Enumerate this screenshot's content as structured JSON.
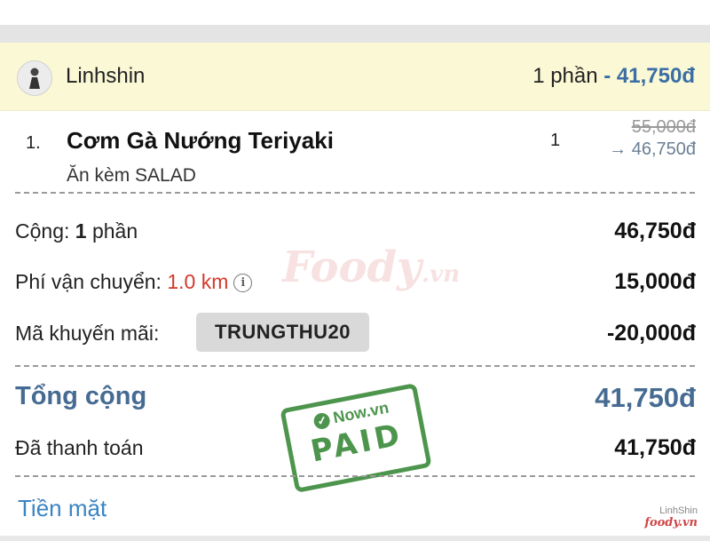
{
  "user": {
    "name": "Linhshin",
    "summary_count": "1 phần",
    "summary_amount": "- 41,750đ"
  },
  "items": [
    {
      "index": "1.",
      "name": "Cơm Gà Nướng Teriyaki",
      "note": "Ăn kèm SALAD",
      "quantity": "1",
      "original_price": "55,000đ",
      "discounted_price": "→ 46,750đ"
    }
  ],
  "summary": {
    "subtotal_label_prefix": "Cộng: ",
    "subtotal_count": "1",
    "subtotal_label_suffix": " phần",
    "subtotal_value": "46,750đ",
    "shipping_label": "Phí vận chuyển: ",
    "shipping_distance": "1.0 km",
    "shipping_value": "15,000đ",
    "promo_label": "Mã khuyến mãi:",
    "promo_code": "TRUNGTHU20",
    "promo_value": "-20,000đ",
    "total_label": "Tổng cộng",
    "total_value": "41,750đ",
    "paid_label": "Đã thanh toán",
    "paid_value": "41,750đ"
  },
  "payment_method": "Tiền mặt",
  "watermark": {
    "brand": "Foody",
    "suffix": ".vn"
  },
  "stamp": {
    "brand": "Now.vn",
    "status": "PAID"
  },
  "corner_watermark": {
    "author": "LinhShin",
    "brand": "foody.vn"
  },
  "colors": {
    "accent": "#466b93",
    "link": "#3a84c4",
    "distance": "#d23a2a",
    "highlight_row": "#fbf8d6",
    "stamp_green": "#3a8a3a"
  },
  "icons": {
    "info": "info-circle-icon",
    "check": "check-circle-icon"
  }
}
